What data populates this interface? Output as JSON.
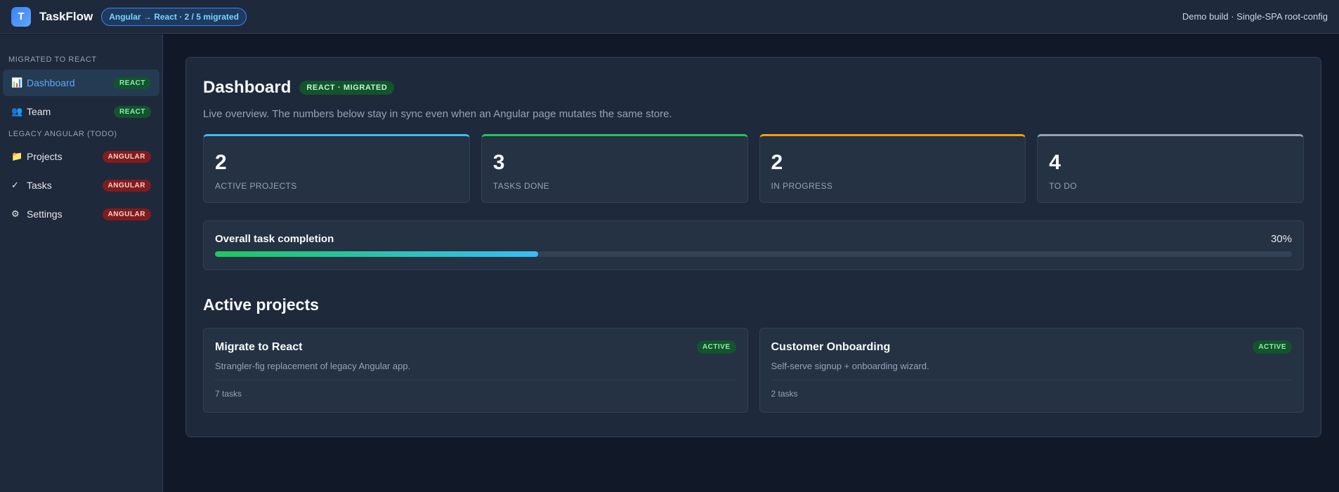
{
  "topbar": {
    "logo_letter": "T",
    "brand": "TaskFlow",
    "migration_status": "Angular → React · 2 / 5 migrated",
    "demo_note": "Demo build · Single-SPA root-config"
  },
  "sidebar": {
    "section_migrated": "Migrated to React",
    "section_legacy": "Legacy Angular (todo)",
    "migrated_items": [
      {
        "icon": "📊",
        "label": "Dashboard",
        "badge": "REACT"
      },
      {
        "icon": "👥",
        "label": "Team",
        "badge": "REACT"
      }
    ],
    "legacy_items": [
      {
        "icon": "📁",
        "label": "Projects",
        "badge": "ANGULAR"
      },
      {
        "icon": "✓",
        "label": "Tasks",
        "badge": "ANGULAR"
      },
      {
        "icon": "⚙",
        "label": "Settings",
        "badge": "ANGULAR"
      }
    ]
  },
  "dashboard": {
    "title": "Dashboard",
    "title_badge": "REACT · MIGRATED",
    "subtitle": "Live overview. The numbers below stay in sync even when an Angular page mutates the same store.",
    "stats": [
      {
        "value": "2",
        "label": "Active projects",
        "accent": "#38bdf8"
      },
      {
        "value": "3",
        "label": "Tasks done",
        "accent": "#22c55e"
      },
      {
        "value": "2",
        "label": "In progress",
        "accent": "#f59e0b"
      },
      {
        "value": "4",
        "label": "To do",
        "accent": "#94a3b8"
      }
    ],
    "progress": {
      "title": "Overall task completion",
      "percent_label": "30%",
      "percent": 30
    },
    "projects_title": "Active projects",
    "projects": [
      {
        "name": "Migrate to React",
        "status": "ACTIVE",
        "description": "Strangler-fig replacement of legacy Angular app.",
        "task_count": "7 tasks"
      },
      {
        "name": "Customer Onboarding",
        "status": "ACTIVE",
        "description": "Self-serve signup + onboarding wizard.",
        "task_count": "2 tasks"
      }
    ]
  }
}
